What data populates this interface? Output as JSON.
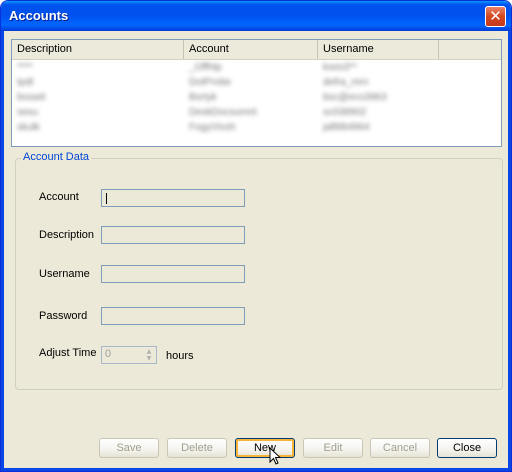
{
  "window": {
    "title": "Accounts",
    "close_glyph": "✕"
  },
  "list": {
    "columns": [
      "Description",
      "Account",
      "Username"
    ],
    "rows": [
      [
        "****",
        "_Offhtp",
        "kses3**"
      ],
      [
        "tpdl",
        "DotProbe",
        "defra_mrn"
      ],
      [
        "boswit",
        "Bsrtyk",
        "bsc@ecs3963"
      ],
      [
        "sesu",
        "DeskDocsumnt",
        "sc038902"
      ],
      [
        "skulk",
        "FogyVivsh",
        "jaf88t4964"
      ]
    ]
  },
  "group": {
    "legend": "Account Data",
    "labels": {
      "account": "Account",
      "description": "Description",
      "username": "Username",
      "password": "Password",
      "adjust_time": "Adjust Time"
    },
    "adjust_value": "0",
    "hours_label": "hours"
  },
  "buttons": {
    "save": "Save",
    "delete": "Delete",
    "new": "New",
    "edit": "Edit",
    "cancel": "Cancel",
    "close": "Close"
  },
  "icons": {
    "close": "close-icon",
    "cursor": "mouse-cursor-icon",
    "spin_up": "▲",
    "spin_down": "▼"
  }
}
